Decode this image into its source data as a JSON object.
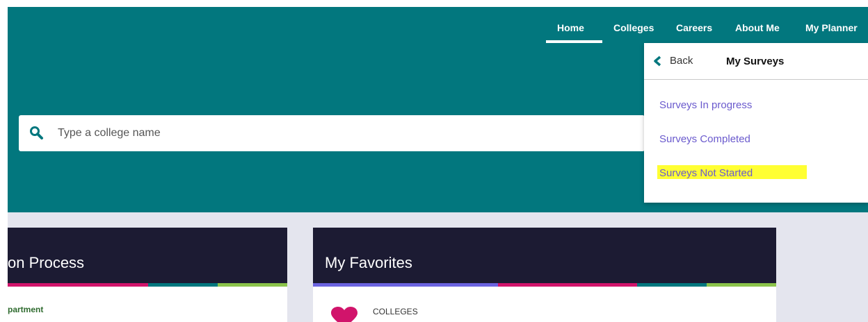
{
  "nav": {
    "items": [
      "Home",
      "Colleges",
      "Careers",
      "About Me",
      "My Planner"
    ],
    "active": "Home"
  },
  "search": {
    "placeholder": "Type a college name",
    "icon": "search-icon"
  },
  "dropdown": {
    "back_label": "Back",
    "title": "My Surveys",
    "links": [
      "Surveys In progress",
      "Surveys Completed",
      "Surveys Not Started"
    ],
    "highlighted": "Surveys Not Started"
  },
  "cards": {
    "left": {
      "title": "on Process",
      "subtext": "partment"
    },
    "right": {
      "title": "My Favorites",
      "section_label": "COLLEGES"
    }
  },
  "colors": {
    "teal": "#02777e",
    "navy": "#1c1b33",
    "link": "#6a5acd",
    "magenta": "#d1146b",
    "lime": "#8bc34a",
    "highlight": "#ffff33"
  }
}
